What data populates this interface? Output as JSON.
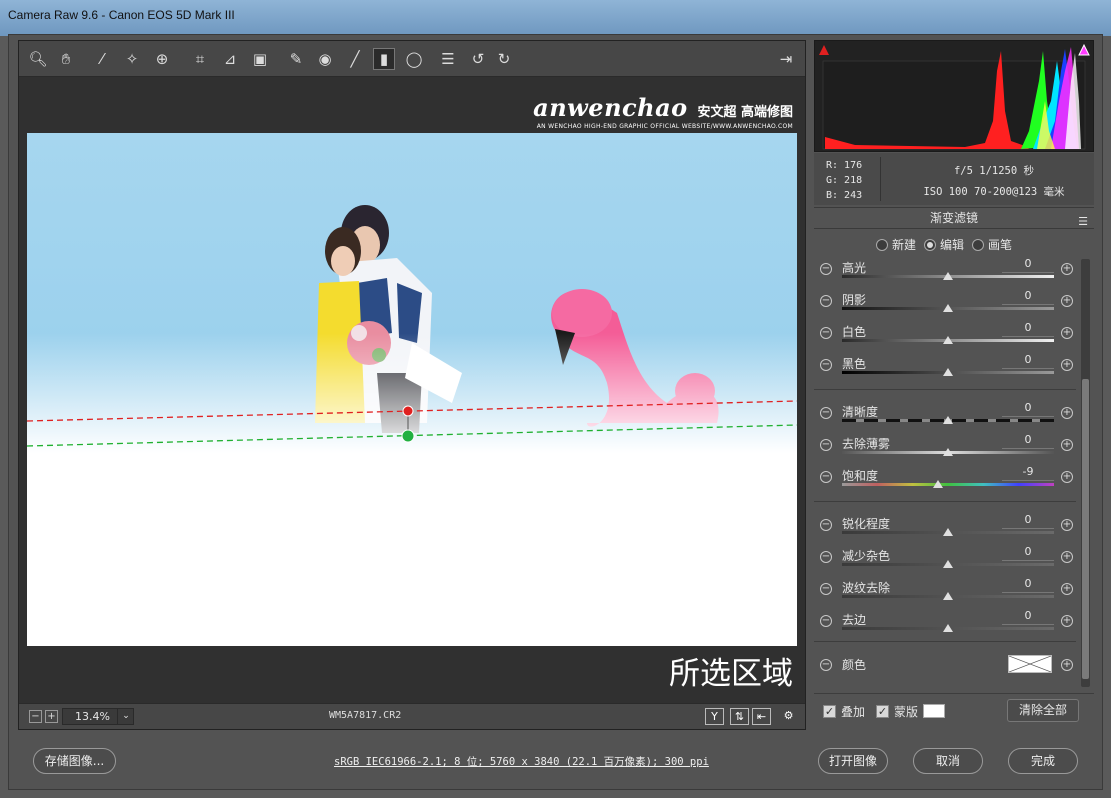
{
  "window": {
    "title": "Camera Raw 9.6  -  Canon EOS 5D Mark III"
  },
  "toolbar": {
    "tools": [
      {
        "name": "zoom-tool-icon",
        "glyph": "🔍︎"
      },
      {
        "name": "hand-tool-icon",
        "glyph": "✋︎"
      },
      {
        "name": "white-balance-tool-icon",
        "glyph": "⁄"
      },
      {
        "name": "color-sampler-icon",
        "glyph": "✧"
      },
      {
        "name": "targeted-adjustment-icon",
        "glyph": "⊕"
      },
      {
        "name": "crop-tool-icon",
        "glyph": "⌗"
      },
      {
        "name": "straighten-tool-icon",
        "glyph": "⊿"
      },
      {
        "name": "transform-tool-icon",
        "glyph": "▣"
      },
      {
        "name": "spot-removal-icon",
        "glyph": "✎"
      },
      {
        "name": "red-eye-icon",
        "glyph": "◉"
      },
      {
        "name": "adjustment-brush-icon",
        "glyph": "╱"
      },
      {
        "name": "graduated-filter-icon",
        "glyph": "▮"
      },
      {
        "name": "radial-filter-icon",
        "glyph": "◯"
      },
      {
        "name": "preferences-icon",
        "glyph": "☰"
      },
      {
        "name": "rotate-left-icon",
        "glyph": "↺"
      },
      {
        "name": "rotate-right-icon",
        "glyph": "↻"
      }
    ],
    "fullscreen_glyph": "⇥"
  },
  "watermark": {
    "brand": "anwenchao",
    "brand_cn": "安文超 高端修图",
    "tagline": "AN WENCHAO HIGH-END GRAPHIC OFFICIAL WEBSITE/WWW.ANWENCHAO.COM"
  },
  "preview": {
    "overlay_label": "所选区域"
  },
  "statusbar": {
    "zoom_minus": "−",
    "zoom_plus": "+",
    "zoom_value": "13.4%",
    "zoom_arrow": "⌄",
    "filename": "WM5A7817.CR2",
    "before_after_y": "Y",
    "swap_glyph": "⇅",
    "copy_glyph": "⇤",
    "settings_glyph": "⚙"
  },
  "readout": {
    "r": "R:  176",
    "g": "G:  218",
    "b": "B:  243",
    "exposure": "f/5   1/1250 秒",
    "iso_lens": "ISO 100   70-200@123 毫米"
  },
  "panel": {
    "title": "渐变滤镜",
    "menu_glyph": "☰",
    "modes": [
      {
        "label": "新建",
        "selected": false
      },
      {
        "label": "编辑",
        "selected": true
      },
      {
        "label": "画笔",
        "selected": false
      }
    ],
    "sliders": [
      {
        "label": "高光",
        "value": "0",
        "level": 0.5
      },
      {
        "label": "阴影",
        "value": "0",
        "level": 0.5
      },
      {
        "label": "白色",
        "value": "0",
        "level": 0.5
      },
      {
        "label": "黑色",
        "value": "0",
        "level": 0.5
      },
      {
        "label": "清晰度",
        "value": "0",
        "level": 0.5
      },
      {
        "label": "去除薄雾",
        "value": "0",
        "level": 0.5
      },
      {
        "label": "饱和度",
        "value": "-9",
        "level": 0.455
      },
      {
        "label": "锐化程度",
        "value": "0",
        "level": 0.5
      },
      {
        "label": "减少杂色",
        "value": "0",
        "level": 0.5
      },
      {
        "label": "波纹去除",
        "value": "0",
        "level": 0.5
      },
      {
        "label": "去边",
        "value": "0",
        "level": 0.5
      }
    ],
    "color_label": "颜色"
  },
  "options": {
    "overlay_label": "叠加",
    "overlay_checked": true,
    "mask_label": "蒙版",
    "mask_checked": true,
    "clear_all": "清除全部"
  },
  "footer": {
    "save_image": "存储图像...",
    "color_space": "sRGB IEC61966-2.1; 8 位; 5760 x 3840 (22.1 百万像素); 300 ppi",
    "open_image": "打开图像",
    "cancel": "取消",
    "done": "完成"
  },
  "colors": {
    "mask_line_red": "#e02020",
    "mask_line_green": "#20b030",
    "sky": "#9fd3ee"
  }
}
